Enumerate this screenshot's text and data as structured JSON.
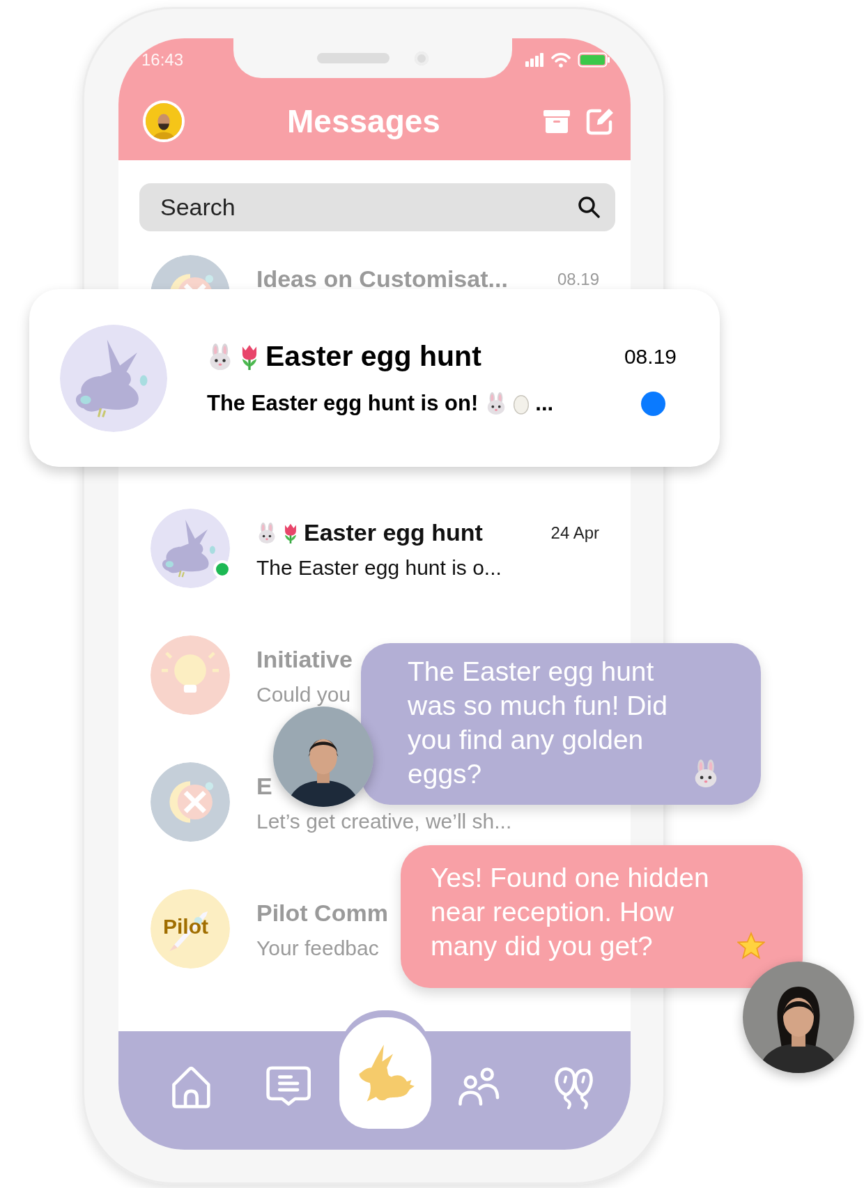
{
  "status_bar": {
    "time": "16:43"
  },
  "header": {
    "title": "Messages"
  },
  "search": {
    "placeholder": "Search"
  },
  "conversations": [
    {
      "avatar": {
        "kind": "tools"
      },
      "title": "Ideas on Customisat...",
      "time": "08.19",
      "online": false,
      "dimmed": true
    },
    {
      "avatar": {
        "kind": "rabbit"
      },
      "title_icons": [
        {
          "kind": "bunny"
        },
        {
          "kind": "tulip"
        }
      ],
      "title": "Easter egg hunt",
      "time": "24 Apr",
      "preview": "The Easter egg hunt is o...",
      "online": true,
      "dimmed": false
    },
    {
      "avatar": {
        "kind": "bulb"
      },
      "title": "Initiative",
      "preview": "Could you",
      "online": false,
      "dimmed": true
    },
    {
      "avatar": {
        "kind": "tools"
      },
      "title": "E",
      "preview": "Let’s get creative, we’ll sh...",
      "online": false,
      "dimmed": true
    },
    {
      "avatar": {
        "kind": "rocket"
      },
      "avatar_label": "Pilot",
      "title": "Pilot Comm",
      "preview": "Your feedbac",
      "online": false,
      "dimmed": true
    }
  ],
  "highlighted_conversation": {
    "avatar": {
      "kind": "rabbit"
    },
    "title_icons": [
      {
        "kind": "bunny"
      },
      {
        "kind": "tulip"
      }
    ],
    "title": "Easter egg hunt",
    "time": "08.19",
    "preview": "The Easter egg hunt is on!",
    "preview_icons": [
      {
        "kind": "bunny"
      },
      {
        "kind": "egg"
      }
    ],
    "preview_tail": "...",
    "unread": true
  },
  "chat_bubbles": [
    {
      "kind": "incoming",
      "color": "#b3afd5",
      "text": "The Easter egg hunt was so much fun! Did you find any golden eggs?",
      "icons": [
        {
          "kind": "bunny"
        }
      ]
    },
    {
      "kind": "outgoing",
      "color": "#f8a0a6",
      "text": "Yes! Found one hidden near reception. How many did you get?",
      "icons": [
        {
          "kind": "star"
        }
      ]
    }
  ],
  "nav": [
    {
      "kind": "home",
      "selected": false
    },
    {
      "kind": "chat",
      "selected": false
    },
    {
      "kind": "rabbit",
      "selected": true
    },
    {
      "kind": "people",
      "selected": false
    },
    {
      "kind": "balloons",
      "selected": false
    }
  ]
}
